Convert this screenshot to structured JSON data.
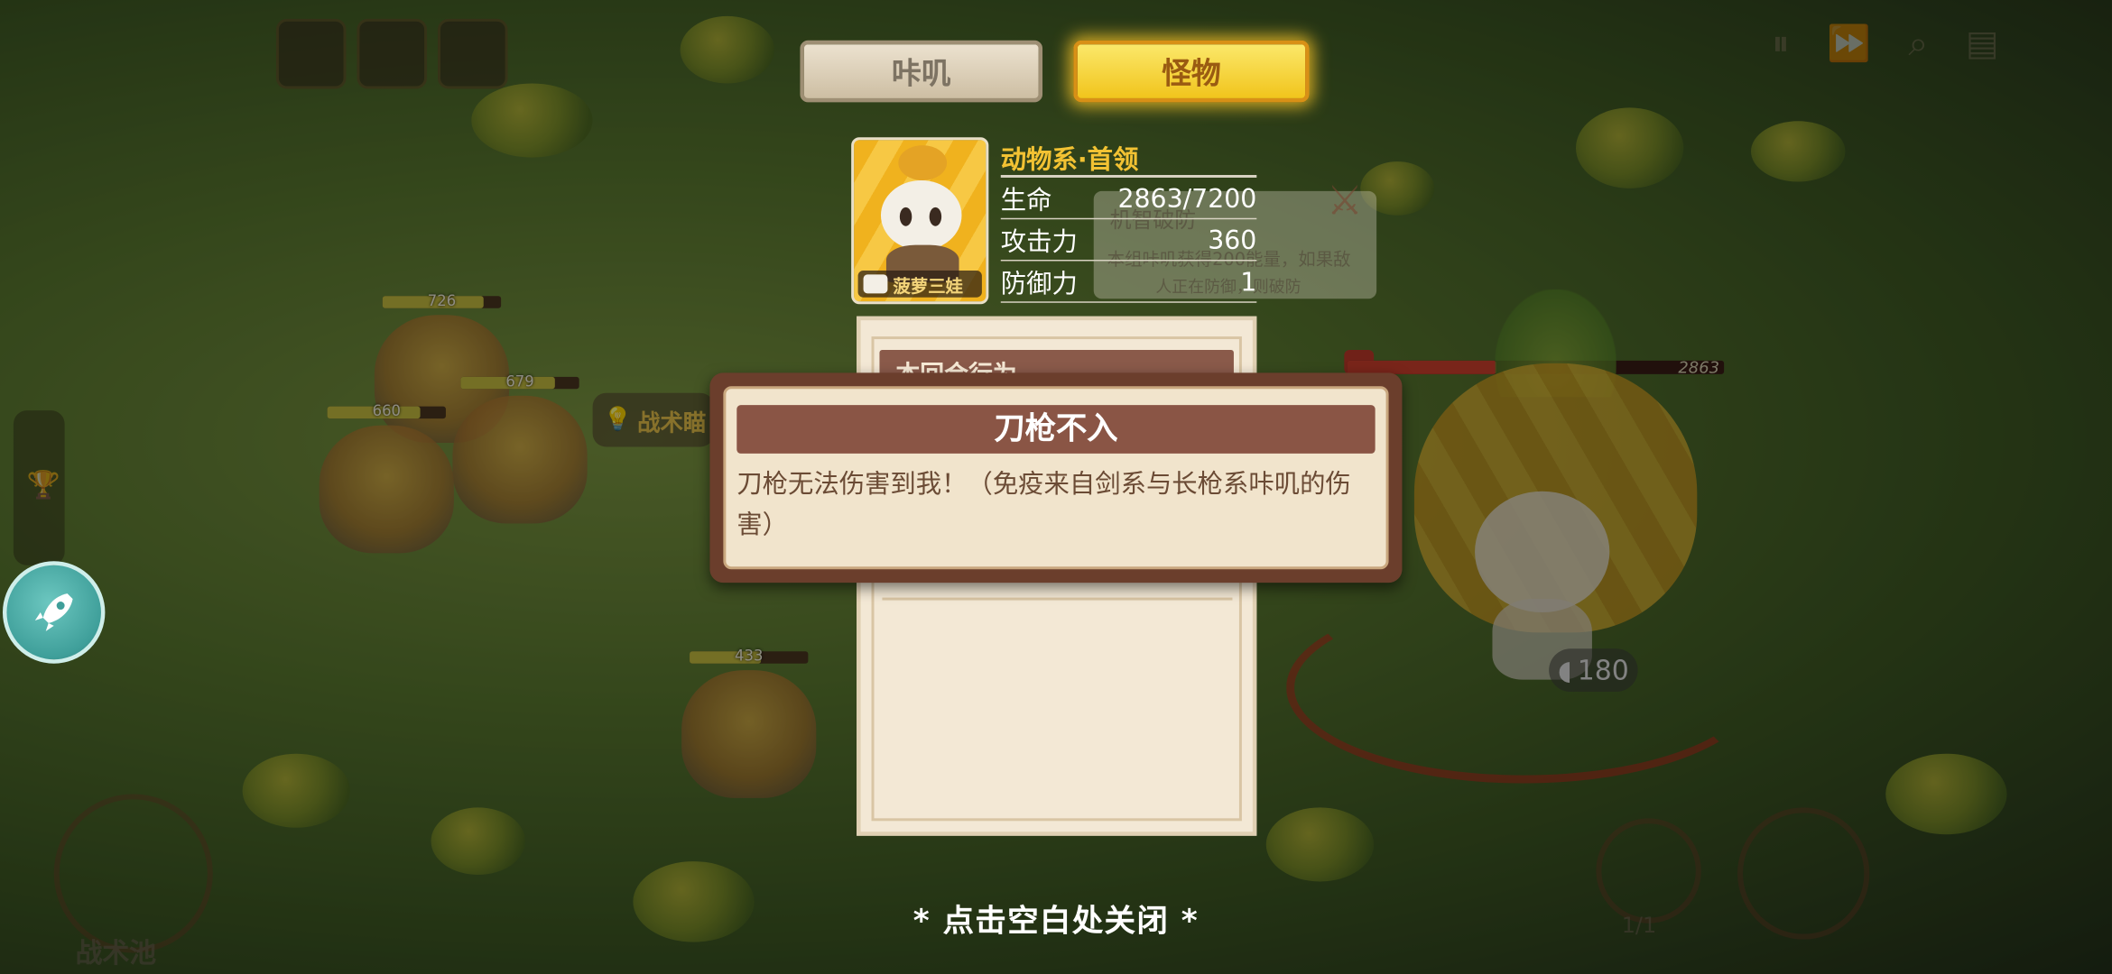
{
  "tabs": {
    "kaji": "咔叽",
    "monster": "怪物"
  },
  "monster": {
    "name": "菠萝三娃",
    "category": "动物系·首领",
    "stats": [
      {
        "label": "生命",
        "value": "2863/7200"
      },
      {
        "label": "攻击力",
        "value": "360"
      },
      {
        "label": "防御力",
        "value": "1"
      }
    ],
    "hp_fraction": 0.3976
  },
  "background_card": {
    "title": "机智破防",
    "line1": "本组咔叽获得200能量，如果敌",
    "line2": "人正在防御，则破防"
  },
  "panel": {
    "header": "本回合行为"
  },
  "tooltip": {
    "title": "刀枪不入",
    "description": "刀枪无法伤害到我！（免疫来自剑系与长枪系咔叽的伤害）"
  },
  "board": {
    "units": [
      {
        "hp": "726"
      },
      {
        "hp": "679"
      },
      {
        "hp": "660"
      },
      {
        "hp": "433"
      }
    ],
    "boss_hp": "2863",
    "tactic_label": "战术瞄",
    "range_value": "180",
    "pool_label": "战术池",
    "turn_counter": "1/1"
  },
  "close_hint": "* 点击空白处关闭 *",
  "colors": {
    "accent_gold": "#f2c233",
    "dialog_brown": "#6b3e2c",
    "tab_active": "#f1c41c"
  }
}
